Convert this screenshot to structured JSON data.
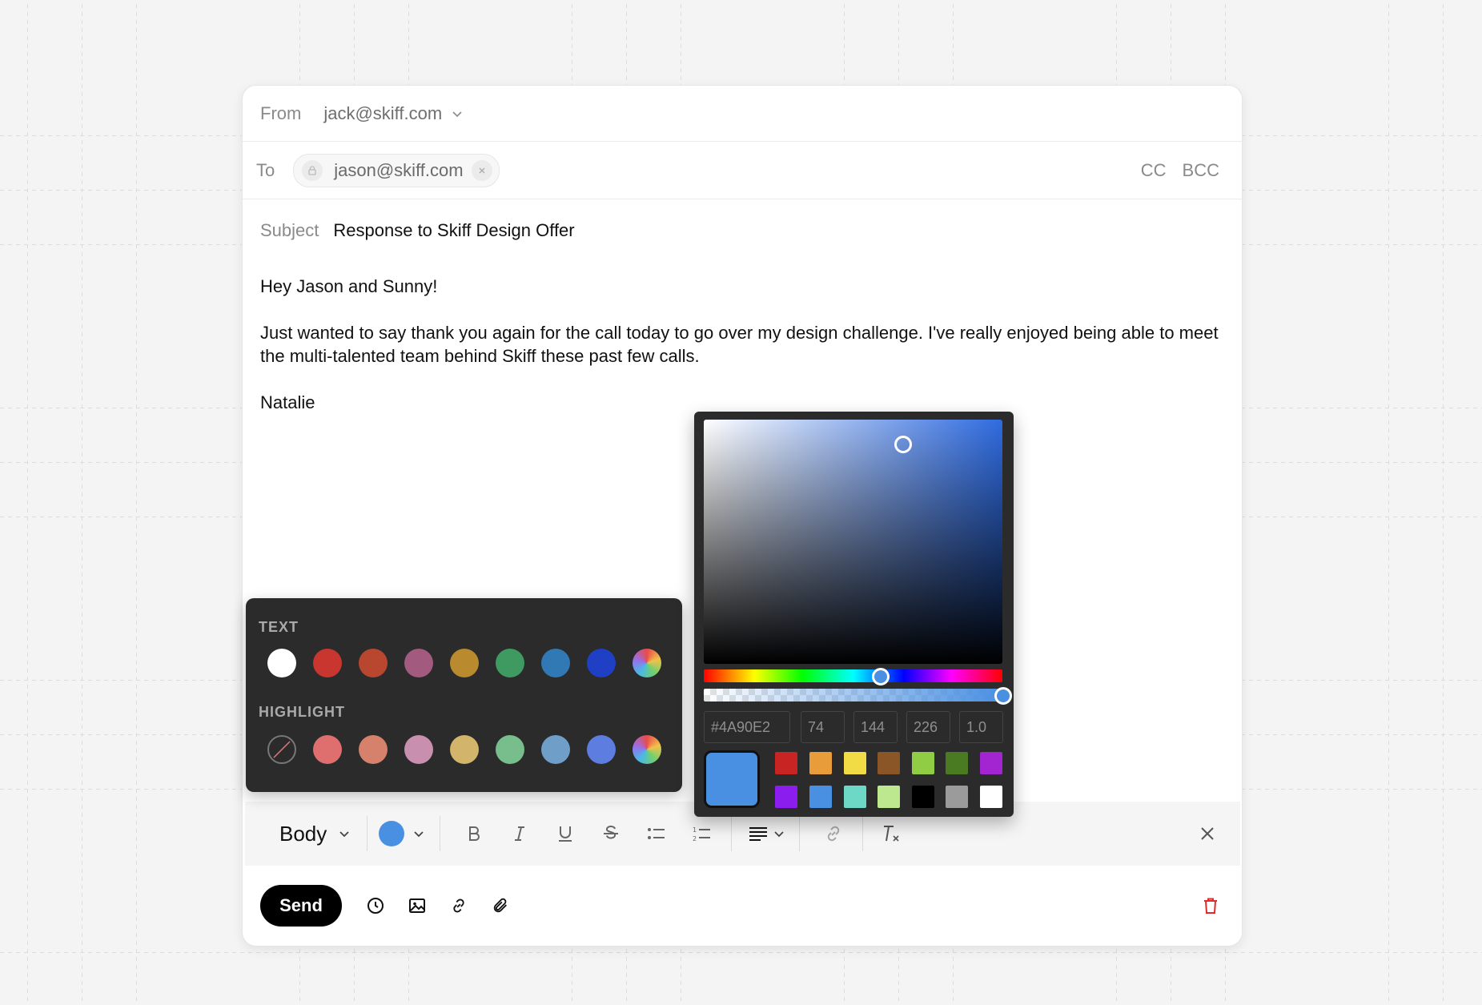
{
  "header": {
    "from_label": "From",
    "from_value": "jack@skiff.com",
    "to_label": "To",
    "to_recipient": "jason@skiff.com",
    "cc_label": "CC",
    "bcc_label": "BCC",
    "subject_label": "Subject",
    "subject_value": "Response to Skiff Design Offer"
  },
  "body": {
    "greeting": "Hey Jason and Sunny!",
    "paragraph": "Just wanted to say thank you again for the call today to go over my design challenge. I've really enjoyed being able to meet the multi-talented team behind Skiff these past few calls.",
    "signature": "Natalie"
  },
  "palette": {
    "text_label": "TEXT",
    "highlight_label": "HIGHLIGHT",
    "text_colors": [
      "#ffffff",
      "#c9352f",
      "#b9472f",
      "#a25a7f",
      "#b98a2e",
      "#3f9a62",
      "#3079b4",
      "#1f40c4",
      "rainbow"
    ],
    "highlight_colors": [
      "none",
      "#df6e6e",
      "#d5816c",
      "#c98fae",
      "#d3b46b",
      "#78bd8c",
      "#6f9ec9",
      "#5d7de0",
      "rainbow"
    ]
  },
  "picker": {
    "hex": "#4A90E2",
    "r": "74",
    "g": "144",
    "b": "226",
    "a": "1.0",
    "preview_color": "#4A90E2",
    "swatches": [
      "#c82423",
      "#e89d3a",
      "#f1dc45",
      "#8a5628",
      "#91cd44",
      "#4a7a22",
      "#a324d1",
      "#8b1dee",
      "#4a90e2",
      "#6ed8c7",
      "#bde88f",
      "#000000",
      "#9b9b9b",
      "#ffffff"
    ]
  },
  "toolbar": {
    "style_label": "Body",
    "text_color": "#4a90e2"
  },
  "actions": {
    "send_label": "Send"
  },
  "colors": {
    "accent": "#4a90e2",
    "delete": "#e02b2b"
  },
  "icons": [
    "chevron-down-icon",
    "lock-icon",
    "close-icon",
    "bold-icon",
    "italic-icon",
    "underline-icon",
    "strikethrough-icon",
    "bullet-list-icon",
    "numbered-list-icon",
    "align-icon",
    "link-icon",
    "clear-format-icon",
    "clock-icon",
    "image-icon",
    "attachment-icon",
    "trash-icon"
  ]
}
